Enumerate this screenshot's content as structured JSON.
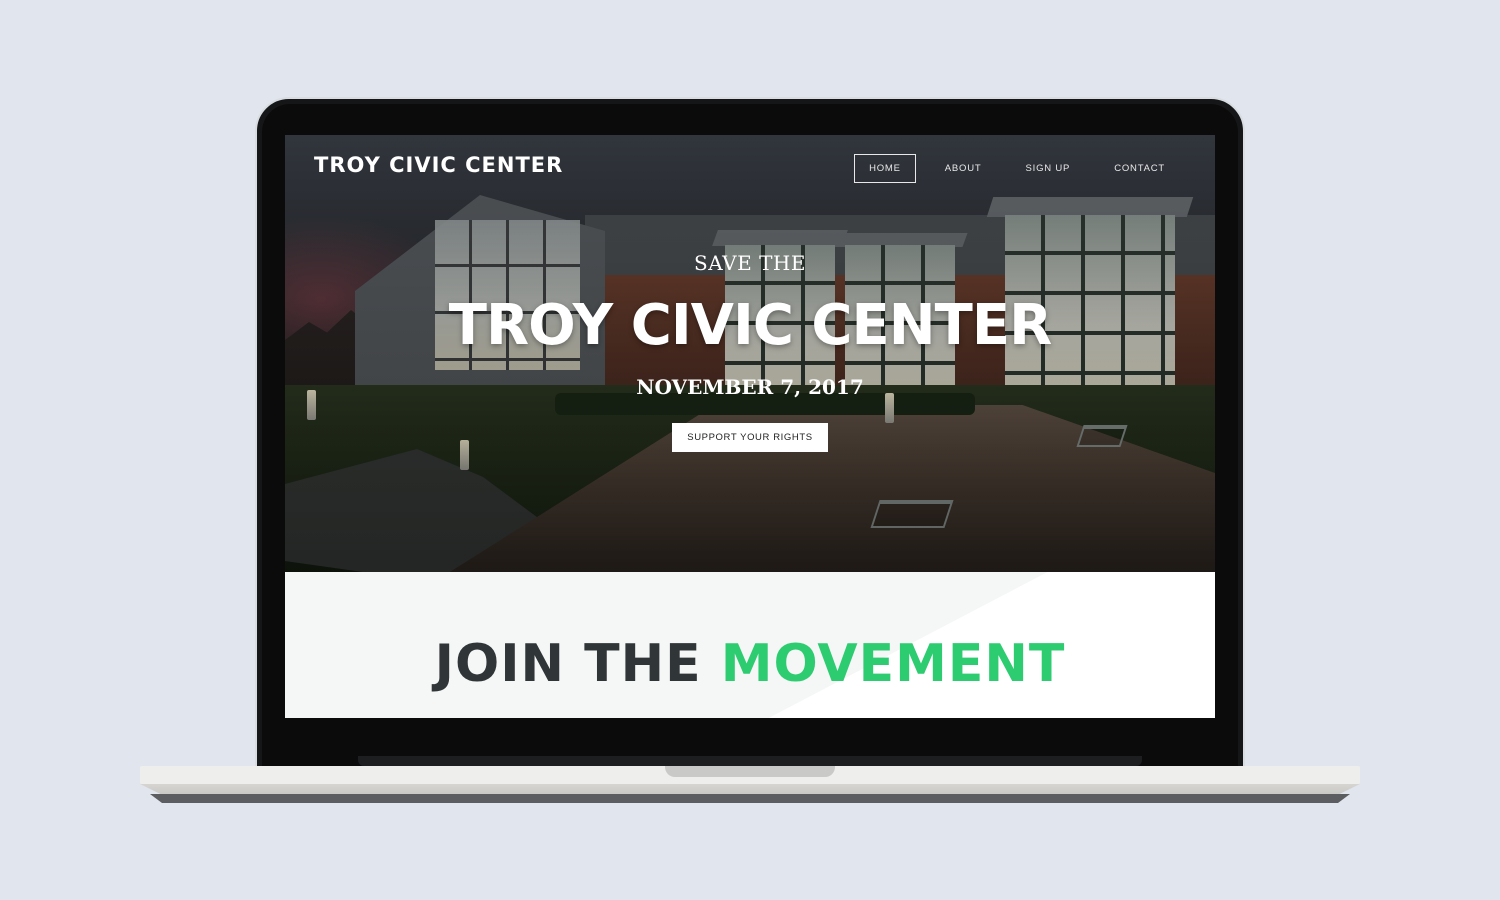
{
  "site": {
    "brand": "TROY CIVIC CENTER",
    "nav": [
      {
        "label": "HOME",
        "active": true
      },
      {
        "label": "ABOUT",
        "active": false
      },
      {
        "label": "SIGN UP",
        "active": false
      },
      {
        "label": "CONTACT",
        "active": false
      }
    ]
  },
  "hero": {
    "kicker": "SAVE THE",
    "headline": "TROY CIVIC CENTER",
    "date": "NOVEMBER 7, 2017",
    "cta_label": "SUPPORT YOUR RIGHTS"
  },
  "join": {
    "title_dark": "JOIN THE ",
    "title_accent": "MOVEMENT"
  },
  "colors": {
    "background": "#e1e6ee",
    "accent_green": "#2ecc71",
    "dark_text": "#303538"
  }
}
